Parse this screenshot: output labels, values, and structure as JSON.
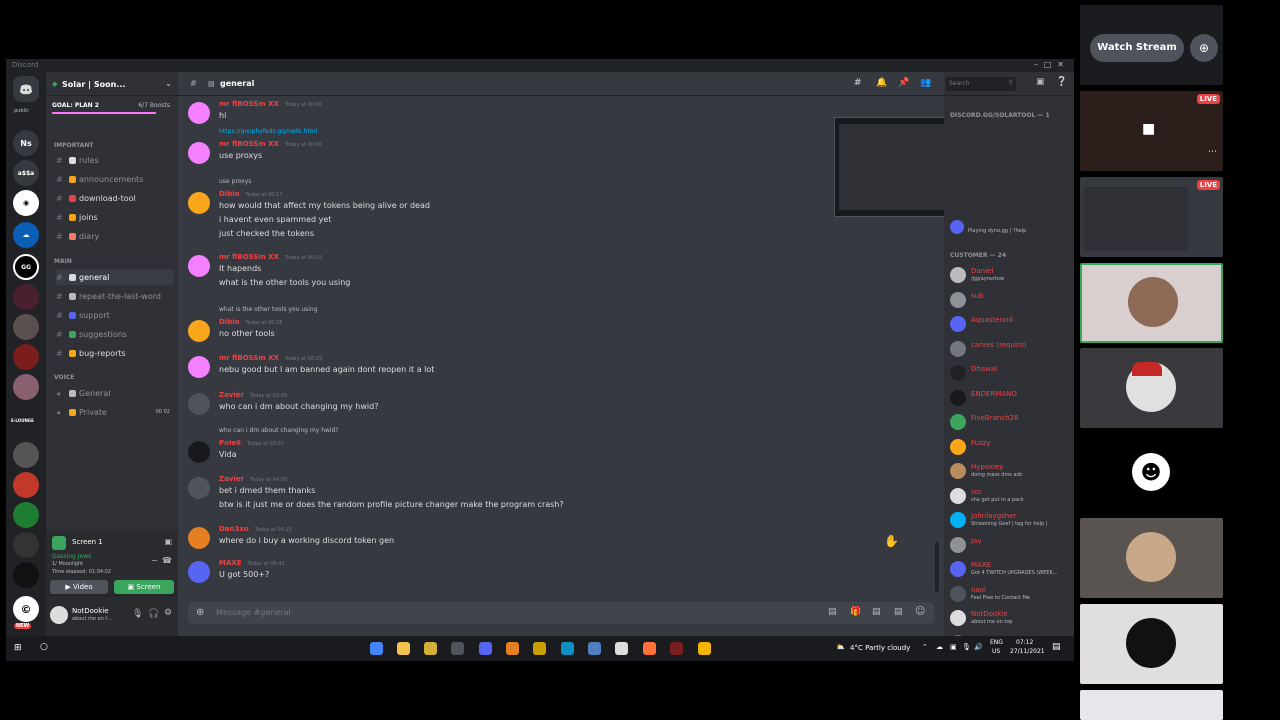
{
  "window": {
    "title": "Discord"
  },
  "server": {
    "name": "Solar | Soon...",
    "goal_label": "GOAL: PLAN 2",
    "boosts": "6/7 Boosts"
  },
  "guilds": {
    "public_label": "public",
    "ns": "Ns",
    "a55a": "a$$a",
    "new_badge": "NEW",
    "lounge": "E-LOUNGE"
  },
  "categories": {
    "important": "IMPORTANT",
    "main": "MAIN",
    "voice": "VOICE"
  },
  "channels_important": [
    {
      "name": "rules",
      "emoji": "#dcddde"
    },
    {
      "name": "announcements",
      "emoji": "#faa61a"
    },
    {
      "name": "download-tool",
      "emoji": "#ed4245"
    },
    {
      "name": "joins",
      "emoji": "#faa61a"
    },
    {
      "name": "diary",
      "emoji": "#f47b67"
    }
  ],
  "channels_main": [
    {
      "name": "general",
      "emoji": "#dcddde"
    },
    {
      "name": "repeat-the-last-word",
      "emoji": "#b9bbbe"
    },
    {
      "name": "support",
      "emoji": "#5865f2"
    },
    {
      "name": "suggestions",
      "emoji": "#3ba55d"
    },
    {
      "name": "bug-reports",
      "emoji": "#faa61a"
    }
  ],
  "channels_voice": [
    {
      "name": "General"
    },
    {
      "name": "Private",
      "count": "00 02"
    }
  ],
  "voice_panel": {
    "title": "Screen 1",
    "status": "Gassing Jews",
    "sub": "1/ Moonlight",
    "elapsed": "Time elapsed: 01:04:02",
    "video_btn": "Video",
    "screen_btn": "Screen"
  },
  "user": {
    "name": "NotDookie",
    "status": "about me on t..."
  },
  "chat": {
    "channel": "general",
    "search_placeholder": "Search",
    "composer_placeholder": "Message #general",
    "messages": [
      {
        "user": "mr flBOSSm XX",
        "ts": "Today at 00:00",
        "lines": [
          "hi"
        ],
        "color": "#ed4245",
        "av": "#f47fff"
      },
      {
        "reply": "https://goophyfeds.gq/nwtk.html",
        "user": "mr flBOSSm XX",
        "ts": "Today at 00:06",
        "lines": [
          "use proxys"
        ],
        "color": "#ed4245",
        "av": "#f47fff"
      },
      {
        "reply": "use proxys",
        "user": "Dibio",
        "ts": "Today at 00:17",
        "lines": [
          "how would that affect my tokens being alive or dead",
          "i havent even spammed yet",
          "just checked the tokens"
        ],
        "color": "#ed4245",
        "av": "#faa61a"
      },
      {
        "user": "mr flBOSSm XX",
        "ts": "Today at 00:19",
        "lines": [
          "It hapends",
          "what is the other tools you using"
        ],
        "color": "#ed4245",
        "av": "#f47fff"
      },
      {
        "reply": "what is the other tools you using",
        "user": "Dibio",
        "ts": "Today at 00:26",
        "lines": [
          "no other tools"
        ],
        "color": "#ed4245",
        "av": "#faa61a"
      },
      {
        "user": "mr flBOSSm XX",
        "ts": "Today at 00:29",
        "lines": [
          "nebu good but I am banned again dont reopen it a lot"
        ],
        "color": "#ed4245",
        "av": "#f47fff"
      },
      {
        "user": "Zavier",
        "ts": "Today at 03:09",
        "lines": [
          "who can i dm about changing my hwid?"
        ],
        "color": "#ed4245",
        "av": "#4f545c"
      },
      {
        "reply": "who can i dm about changing my hwid?",
        "user": "Pole6",
        "ts": "Today at 03:55",
        "lines": [
          "Vida"
        ],
        "color": "#ed4245",
        "av": "#18191c"
      },
      {
        "user": "Zavier",
        "ts": "Today at 04:00",
        "lines": [
          "bet i dmed them thanks",
          "btw is it just me or does the random profile picture changer make the program crash?"
        ],
        "color": "#ed4245",
        "av": "#4f545c"
      },
      {
        "user": "Dan3xo",
        "ts": "Today at 04:10",
        "lines": [
          "where do i buy a working discord token gen"
        ],
        "color": "#ed4245",
        "av": "#e67e22"
      },
      {
        "user": "MAXE",
        "ts": "Today at 06:42",
        "lines": [
          "U got 500+?"
        ],
        "color": "#ed4245",
        "av": "#5865f2"
      }
    ]
  },
  "members": {
    "group1": "DISCORD.GG/SOLARTOOL — 1",
    "group2": "CUSTOMER — 24",
    "bot_activity": "Playing dyno.gg | ?help",
    "list": [
      {
        "name": "Daniel",
        "act": "/gg/ayravtow",
        "color": "#ed4245",
        "av": "#b9bbbe"
      },
      {
        "name": "sub",
        "act": "",
        "color": "#ed4245",
        "av": "#8e9297"
      },
      {
        "name": "Aquasteroid",
        "act": "",
        "color": "#ed4245",
        "av": "#5865f2"
      },
      {
        "name": "carves (requiro)",
        "act": "",
        "color": "#ed4245",
        "av": "#72767d"
      },
      {
        "name": "Dhawal",
        "act": "",
        "color": "#ed4245",
        "av": "#202225"
      },
      {
        "name": "ENDERMANO",
        "act": "",
        "color": "#ed4245",
        "av": "#18191c"
      },
      {
        "name": "FiveBranch28",
        "act": "",
        "color": "#ed4245",
        "av": "#3ba55d"
      },
      {
        "name": "Fuzzy",
        "act": "",
        "color": "#ed4245",
        "av": "#faa61a"
      },
      {
        "name": "Hypoxiey",
        "act": "doing mass dms adc",
        "color": "#ed4245",
        "av": "#b98c5e"
      },
      {
        "name": "ixo",
        "act": "she got put in a pack",
        "color": "#ed4245",
        "av": "#dcddde"
      },
      {
        "name": "Johnlaygsher",
        "act": "Streaming Geef | tag for help |",
        "color": "#ed4245",
        "av": "#00b0f4"
      },
      {
        "name": "Jay",
        "act": "",
        "color": "#ed4245",
        "av": "#8e9297"
      },
      {
        "name": "MAXE",
        "act": "Got 4 TWITCH UPGRADES (WEEK...",
        "color": "#ed4245",
        "av": "#5865f2"
      },
      {
        "name": "naol",
        "act": "Feel Free to Contact Me",
        "color": "#ed4245",
        "av": "#4f545c"
      },
      {
        "name": "NotDookie",
        "act": "about me on top",
        "color": "#ed4245",
        "av": "#dcddde"
      },
      {
        "name": "Nxtgrca",
        "act": "",
        "color": "#ed4245",
        "av": "#72767d"
      }
    ]
  },
  "taskbar": {
    "weather": "4°C  Partly cloudy",
    "lang": "ENG",
    "lang2": "US",
    "time": "07:12",
    "date": "27/11/2021"
  },
  "stream": {
    "watch_label": "Watch Stream",
    "live_label": "LIVE"
  }
}
